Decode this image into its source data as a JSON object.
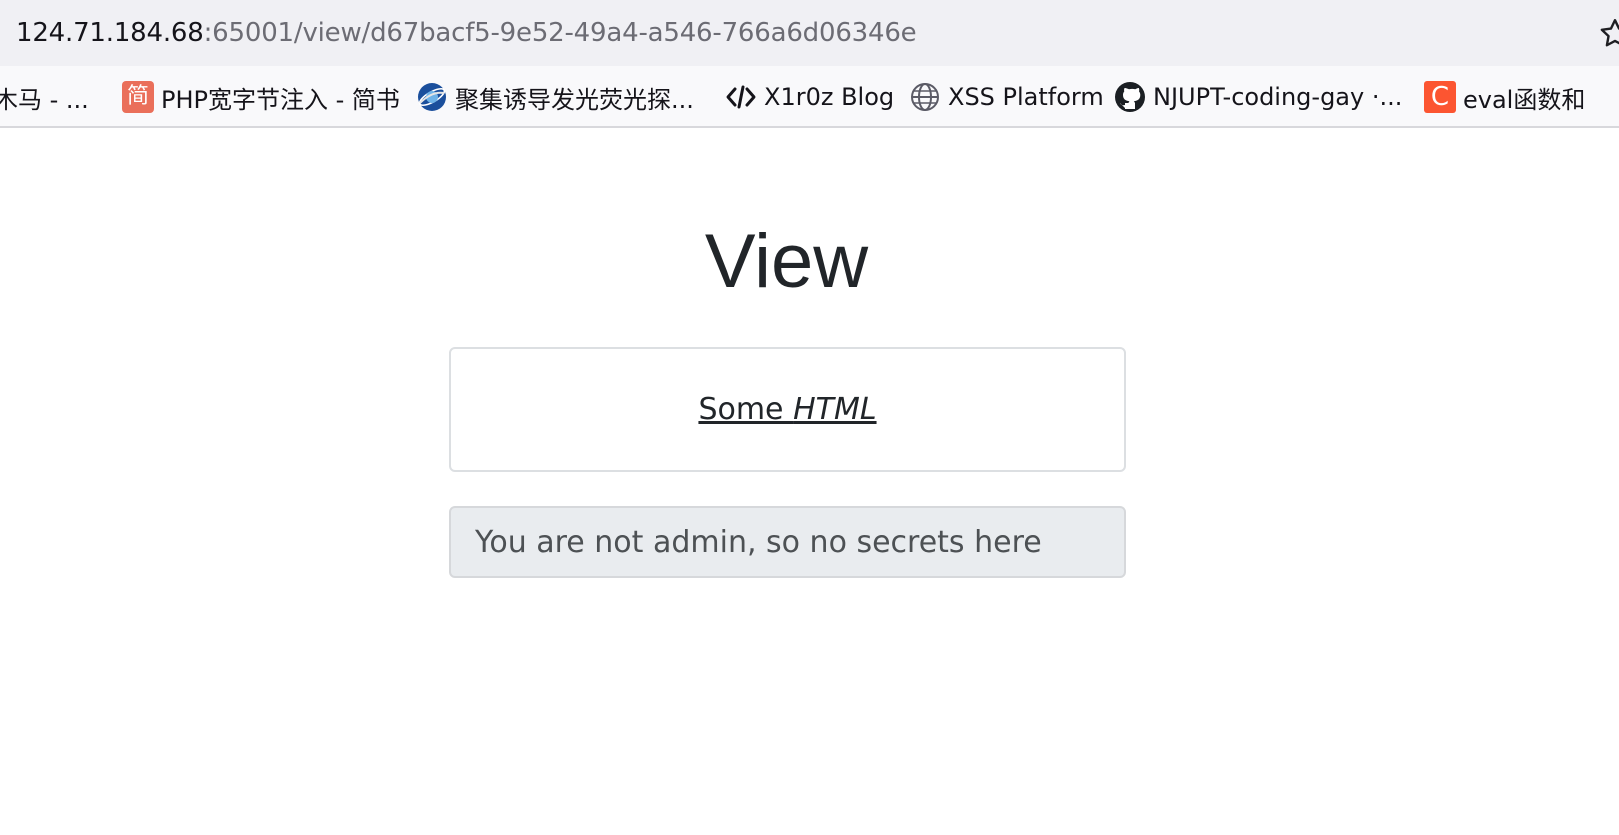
{
  "browser": {
    "url_host": "124.71.184.68",
    "url_path": ":65001/view/d67bacf5-9e52-49a4-a546-766a6d06346e",
    "bookmarks": [
      {
        "label": "木马 - ...",
        "icon": "none"
      },
      {
        "label": "PHP宽字节注入 - 简书",
        "icon": "jianshu-icon",
        "icon_text": "简"
      },
      {
        "label": "聚集诱导发光荧光探...",
        "icon": "globe-blue-icon"
      },
      {
        "label": "X1r0z Blog",
        "icon": "code-icon"
      },
      {
        "label": "XSS Platform",
        "icon": "globe-icon"
      },
      {
        "label": "NJUPT-coding-gay ·...",
        "icon": "github-icon"
      },
      {
        "label": "eval函数和",
        "icon": "csdn-icon",
        "icon_text": "C"
      }
    ]
  },
  "page": {
    "title": "View",
    "content_plain": "Some ",
    "content_italic": "HTML",
    "alert_text": "You are not admin, so no secrets here"
  },
  "colors": {
    "csdn": "#fc5531",
    "jianshu": "#ea6f5a",
    "alert_bg": "#e9ecef"
  }
}
